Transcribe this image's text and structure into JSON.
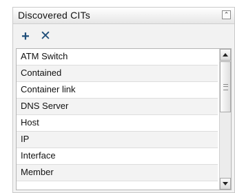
{
  "panel": {
    "title": "Discovered CITs",
    "collapse_icon": "double-chevron-up-icon"
  },
  "toolbar": {
    "add_icon": "plus-icon",
    "remove_icon": "x-icon",
    "add_glyph": "+",
    "remove_glyph": "✕"
  },
  "list": {
    "items": [
      {
        "label": "ATM Switch"
      },
      {
        "label": "Contained"
      },
      {
        "label": "Container link"
      },
      {
        "label": "DNS Server"
      },
      {
        "label": "Host"
      },
      {
        "label": "IP"
      },
      {
        "label": "Interface"
      },
      {
        "label": "Member"
      }
    ]
  }
}
